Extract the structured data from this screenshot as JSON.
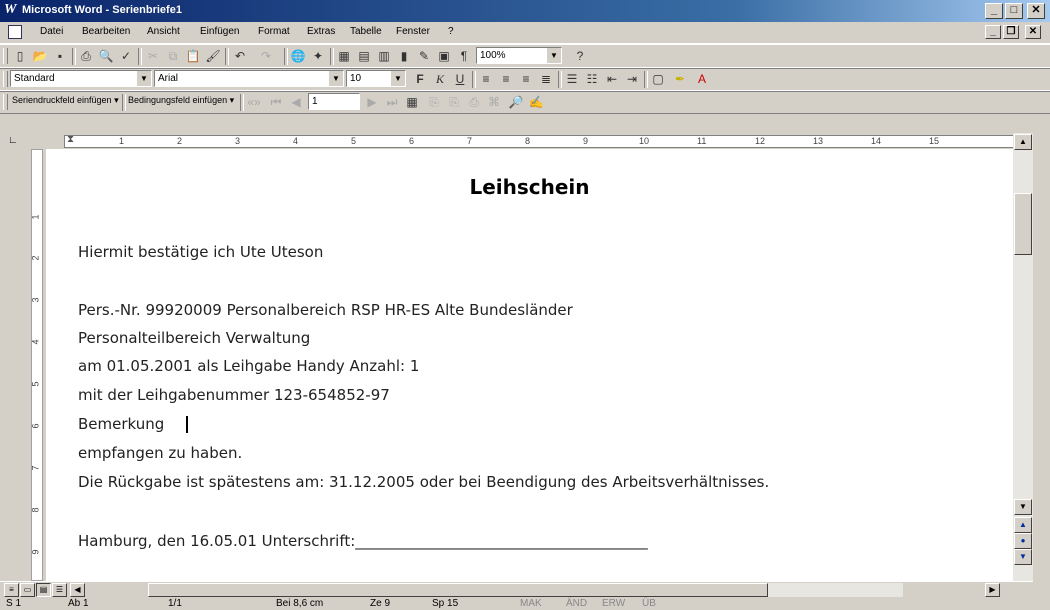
{
  "window": {
    "title": "Microsoft Word - Serienbriefe1",
    "app_icon": "word-w-icon"
  },
  "menu": {
    "items": [
      "Datei",
      "Bearbeiten",
      "Ansicht",
      "Einfügen",
      "Format",
      "Extras",
      "Tabelle",
      "Fenster",
      "?"
    ]
  },
  "toolbar_standard": {
    "zoom": "100%"
  },
  "toolbar_format": {
    "style": "Standard",
    "font": "Arial",
    "size": "10"
  },
  "toolbar_mailmerge": {
    "insert_merge_field": "Seriendruckfeld einfügen ▾",
    "insert_word_field": "Bedingungsfeld einfügen ▾",
    "record": "1"
  },
  "ruler": {
    "numbers": [
      "1",
      "2",
      "3",
      "4",
      "5",
      "6",
      "7",
      "8",
      "9",
      "10",
      "11",
      "12",
      "13",
      "14",
      "15"
    ],
    "vnumbers": [
      "1",
      "2",
      "3",
      "4",
      "5",
      "6",
      "7",
      "8",
      "9"
    ]
  },
  "document": {
    "heading": "Leihschein",
    "lines": [
      "Hiermit bestätige ich Ute Uteson",
      "Pers.-Nr. 99920009   Personalbereich RSP HR-ES Alte Bundesländer",
      "Personalteilbereich Verwaltung",
      "am 01.05.2001 als Leihgabe Handy Anzahl: 1",
      "mit der Leihgabenummer 123-654852-97",
      "Bemerkung",
      "empfangen zu haben.",
      "Die Rückgabe ist spätestens am: 31.12.2005 oder bei Beendigung des Arbeitsverhältnisses.",
      "Hamburg, den 16.05.01    Unterschrift:_______________________________________"
    ]
  },
  "status": {
    "page": "S 1",
    "section": "Ab 1",
    "pages": "1/1",
    "position": "Bei 8,6 cm",
    "line": "Ze 9",
    "column": "Sp 15",
    "flags": [
      "MAK",
      "ÄND",
      "ERW",
      "ÜB"
    ]
  }
}
